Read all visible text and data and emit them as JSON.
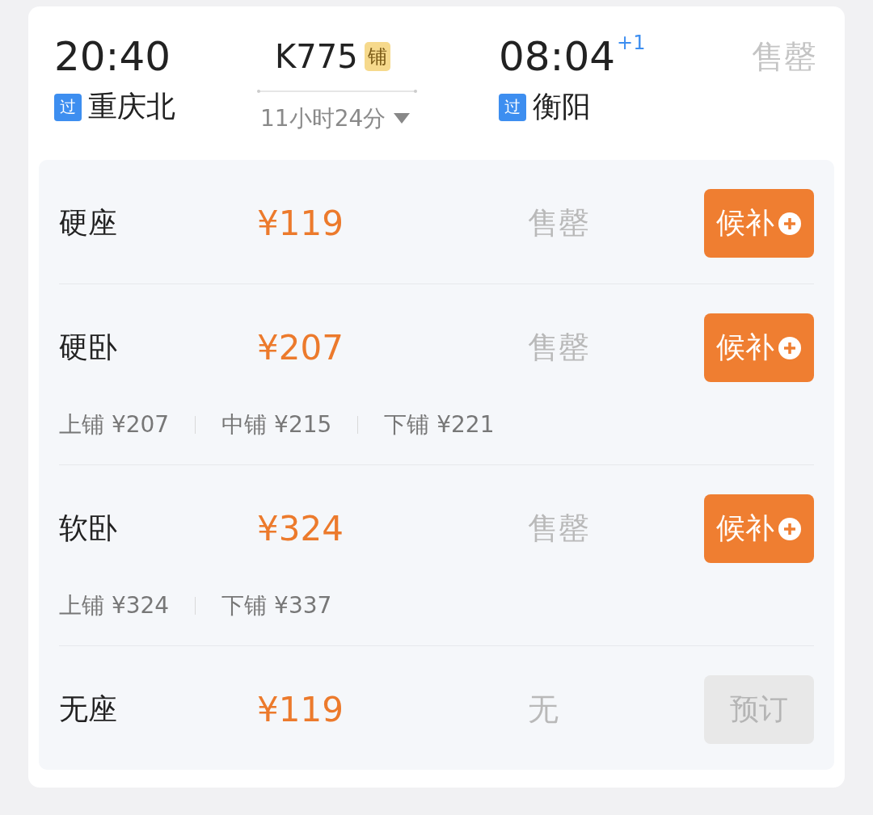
{
  "train": {
    "depart_time": "20:40",
    "depart_station": "重庆北",
    "depart_tag": "过",
    "number": "K775",
    "number_badge": "铺",
    "duration": "11小时24分",
    "arrive_time": "08:04",
    "arrive_day_offset": "+1",
    "arrive_station": "衡阳",
    "arrive_tag": "过",
    "status": "售罄"
  },
  "seats": [
    {
      "name": "硬座",
      "price": "¥119",
      "availability": "售罄",
      "button": {
        "kind": "waitlist",
        "label": "候补",
        "disabled": false
      }
    },
    {
      "name": "硬卧",
      "price": "¥207",
      "availability": "售罄",
      "button": {
        "kind": "waitlist",
        "label": "候补",
        "disabled": false
      },
      "berths": [
        "上铺 ¥207",
        "中铺 ¥215",
        "下铺 ¥221"
      ]
    },
    {
      "name": "软卧",
      "price": "¥324",
      "availability": "售罄",
      "button": {
        "kind": "waitlist",
        "label": "候补",
        "disabled": false
      },
      "berths": [
        "上铺 ¥324",
        "下铺 ¥337"
      ]
    },
    {
      "name": "无座",
      "price": "¥119",
      "availability": "无",
      "button": {
        "kind": "book",
        "label": "预订",
        "disabled": true
      }
    }
  ]
}
